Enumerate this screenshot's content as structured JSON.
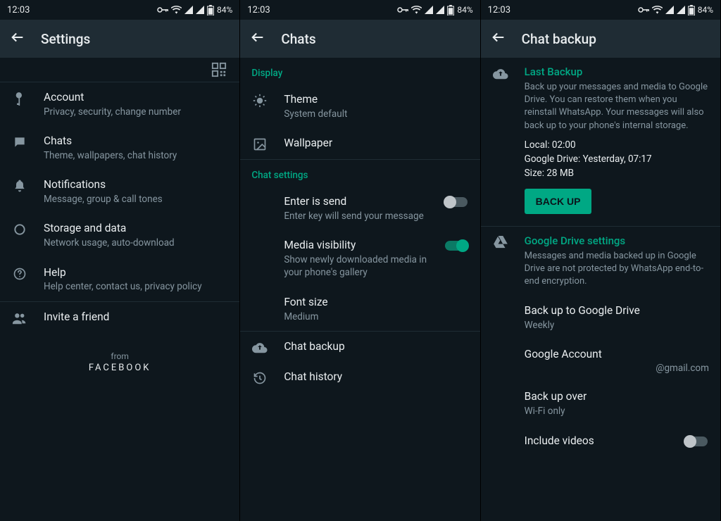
{
  "status": {
    "time": "12:03",
    "battery": "84%"
  },
  "screens": {
    "settings": {
      "title": "Settings",
      "items": {
        "account": {
          "label": "Account",
          "sub": "Privacy, security, change number"
        },
        "chats": {
          "label": "Chats",
          "sub": "Theme, wallpapers, chat history"
        },
        "notif": {
          "label": "Notifications",
          "sub": "Message, group & call tones"
        },
        "storage": {
          "label": "Storage and data",
          "sub": "Network usage, auto-download"
        },
        "help": {
          "label": "Help",
          "sub": "Help center, contact us, privacy policy"
        },
        "invite": {
          "label": "Invite a friend"
        }
      },
      "footer": {
        "from": "from",
        "brand": "FACEBOOK"
      }
    },
    "chats": {
      "title": "Chats",
      "sections": {
        "display": "Display",
        "chat_settings": "Chat settings"
      },
      "theme": {
        "label": "Theme",
        "sub": "System default"
      },
      "wallpaper": {
        "label": "Wallpaper"
      },
      "enter": {
        "label": "Enter is send",
        "sub": "Enter key will send your message",
        "on": false
      },
      "media": {
        "label": "Media visibility",
        "sub": "Show newly downloaded media in your phone's gallery",
        "on": true
      },
      "font": {
        "label": "Font size",
        "sub": "Medium"
      },
      "backup": {
        "label": "Chat backup"
      },
      "history": {
        "label": "Chat history"
      }
    },
    "backup": {
      "title": "Chat backup",
      "last": {
        "heading": "Last Backup",
        "desc": "Back up your messages and media to Google Drive. You can restore them when you reinstall WhatsApp. Your messages will also back up to your phone's internal storage.",
        "local": "Local: 02:00",
        "gdrive": "Google Drive: Yesterday, 07:17",
        "size": "Size: 28 MB",
        "button": "BACK UP"
      },
      "gd": {
        "heading": "Google Drive settings",
        "desc": "Messages and media backed up in Google Drive are not protected by WhatsApp end-to-end encryption.",
        "freq": {
          "label": "Back up to Google Drive",
          "value": "Weekly"
        },
        "account": {
          "label": "Google Account",
          "value": "@gmail.com"
        },
        "over": {
          "label": "Back up over",
          "value": "Wi-Fi only"
        },
        "videos": {
          "label": "Include videos",
          "on": false
        }
      }
    }
  }
}
